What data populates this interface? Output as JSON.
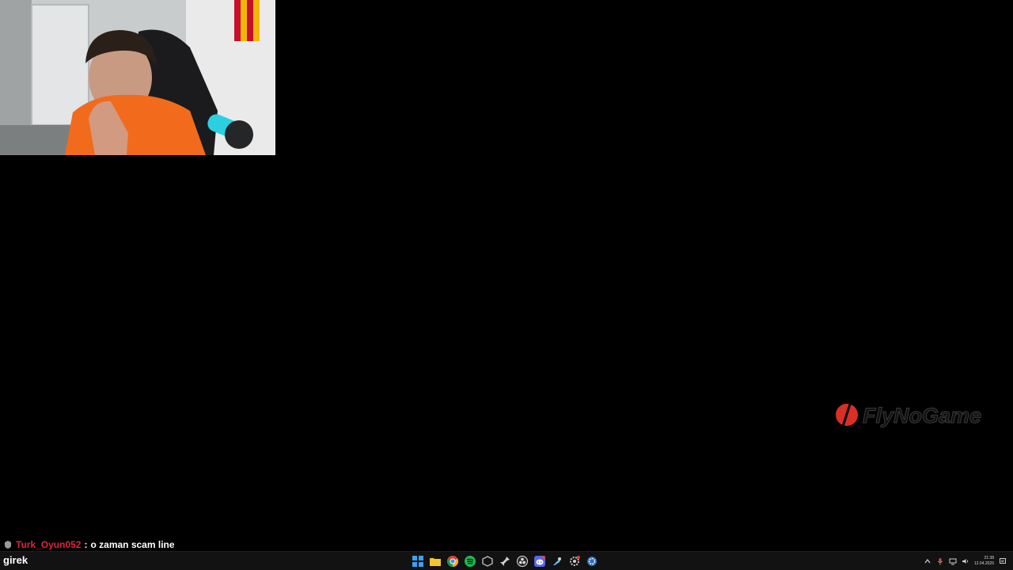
{
  "stream": {
    "watermark_text": "FlyNoGame",
    "colors": {
      "background": "#000000",
      "watermark_red": "#d93025"
    }
  },
  "chat": {
    "username": "Turk_Oyun052",
    "separator": ":",
    "message": "o zaman scam line",
    "username_color": "#e0243a",
    "input_value": "girek"
  },
  "taskbar": {
    "icons": [
      "windows-start-icon",
      "file-explorer-icon",
      "chrome-icon",
      "spotify-icon",
      "app-cube-icon",
      "pin-icon",
      "obs-icon",
      "discord-icon",
      "steam-icon",
      "app-gear-icon",
      "app-settings-icon"
    ],
    "clock": {
      "time": "21:38",
      "date": "12.04.2026"
    }
  }
}
